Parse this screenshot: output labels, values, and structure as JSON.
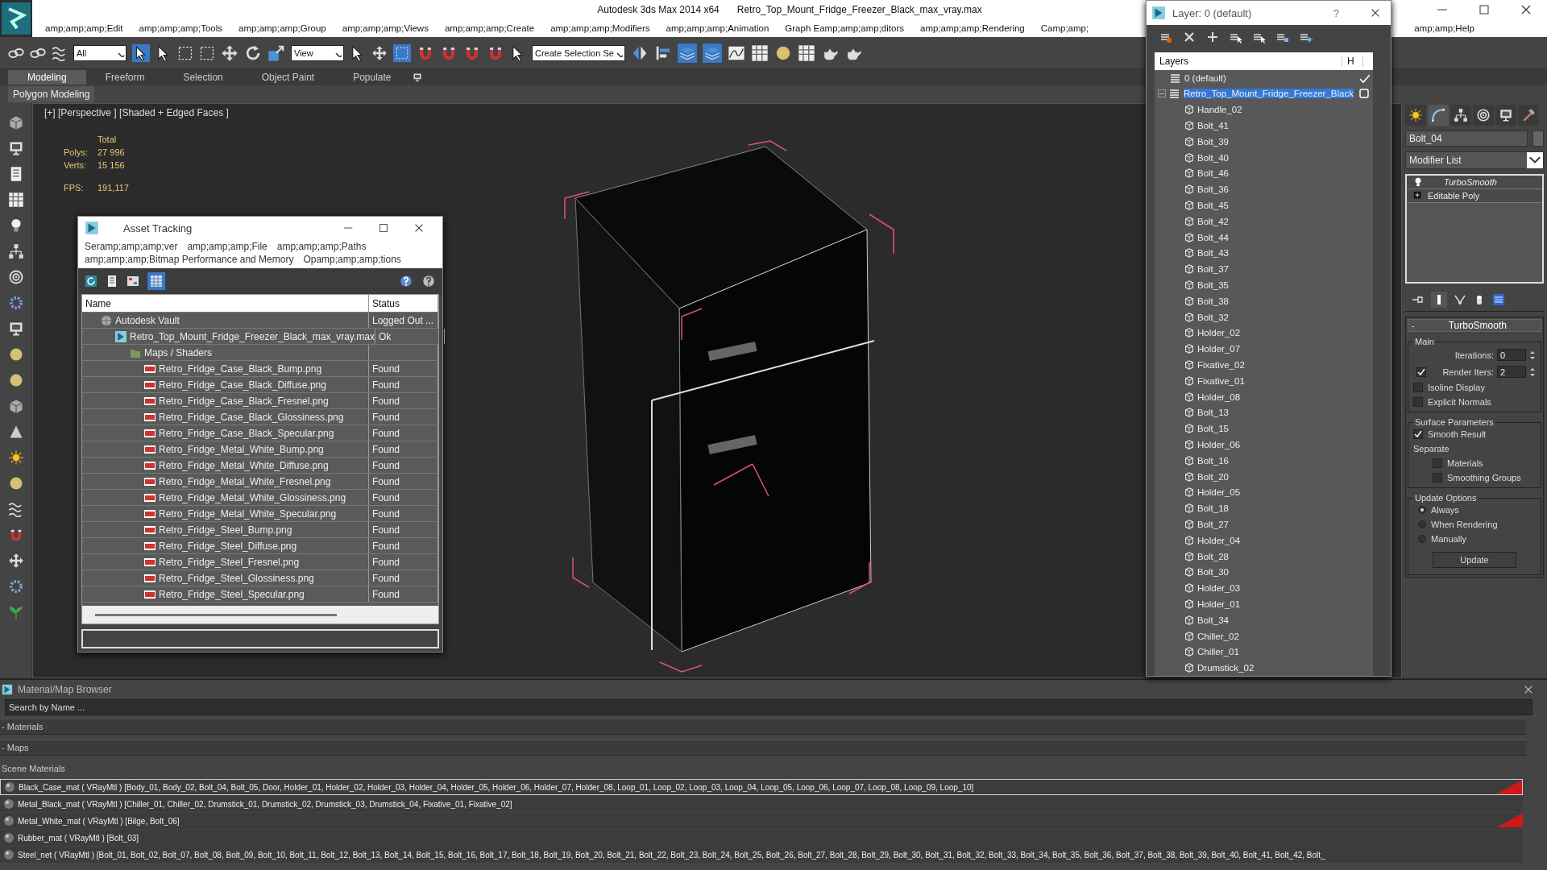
{
  "window": {
    "app_title": "Autodesk 3ds Max  2014 x64",
    "file_title": "Retro_Top_Mount_Fridge_Freezer_Black_max_vray.max"
  },
  "menu": [
    "amp;amp;amp;Edit",
    "amp;amp;amp;Tools",
    "amp;amp;amp;Group",
    "amp;amp;amp;Views",
    "amp;amp;amp;Create",
    "amp;amp;amp;Modifiers",
    "amp;amp;amp;Animation",
    "Graph Eamp;amp;amp;ditors",
    "amp;amp;amp;Rendering",
    "Camp;amp;",
    "amp;amp;Help"
  ],
  "toolbar": {
    "selection_filter": "All",
    "reference_coord": "View",
    "named_selection": "Create Selection Se"
  },
  "ribbon": {
    "tabs": [
      {
        "label": "Modeling",
        "selected": true
      },
      {
        "label": "Freeform",
        "selected": false
      },
      {
        "label": "Selection",
        "selected": false
      },
      {
        "label": "Object Paint",
        "selected": false
      },
      {
        "label": "Populate",
        "selected": false
      }
    ],
    "panel_label": "Polygon Modeling"
  },
  "viewport": {
    "label": "[+] [Perspective ] [Shaded + Edged Faces ]",
    "stats_heading": "Total",
    "stats": [
      {
        "label": "Polys:",
        "value": "27 996"
      },
      {
        "label": "Verts:",
        "value": "15 156"
      },
      {
        "label": "FPS:",
        "value": "191,117"
      }
    ]
  },
  "asset_tracking": {
    "title": "Asset Tracking",
    "menu": [
      "Seramp;amp;amp;ver",
      "amp;amp;amp;File",
      "amp;amp;amp;Paths",
      "amp;amp;amp;Bitmap Performance and Memory",
      "Opamp;amp;amp;tions"
    ],
    "columns": [
      "Name",
      "Status"
    ],
    "rows": [
      {
        "name": "Autodesk Vault",
        "kind": "vault",
        "status": "Logged Out ...",
        "children": [
          {
            "name": "Retro_Top_Mount_Fridge_Freezer_Black_max_vray.max",
            "kind": "scene",
            "status": "Ok",
            "children": [
              {
                "name": "Maps / Shaders",
                "kind": "folder",
                "children": [
                  {
                    "name": "Retro_Fridge_Case_Black_Bump.png",
                    "kind": "png",
                    "status": "Found"
                  },
                  {
                    "name": "Retro_Fridge_Case_Black_Diffuse.png",
                    "kind": "png",
                    "status": "Found"
                  },
                  {
                    "name": "Retro_Fridge_Case_Black_Fresnel.png",
                    "kind": "png",
                    "status": "Found"
                  },
                  {
                    "name": "Retro_Fridge_Case_Black_Glossiness.png",
                    "kind": "png",
                    "status": "Found"
                  },
                  {
                    "name": "Retro_Fridge_Case_Black_Specular.png",
                    "kind": "png",
                    "status": "Found"
                  },
                  {
                    "name": "Retro_Fridge_Metal_White_Bump.png",
                    "kind": "png",
                    "status": "Found"
                  },
                  {
                    "name": "Retro_Fridge_Metal_White_Diffuse.png",
                    "kind": "png",
                    "status": "Found"
                  },
                  {
                    "name": "Retro_Fridge_Metal_White_Fresnel.png",
                    "kind": "png",
                    "status": "Found"
                  },
                  {
                    "name": "Retro_Fridge_Metal_White_Glossiness.png",
                    "kind": "png",
                    "status": "Found"
                  },
                  {
                    "name": "Retro_Fridge_Metal_White_Specular.png",
                    "kind": "png",
                    "status": "Found"
                  },
                  {
                    "name": "Retro_Fridge_Steel_Bump.png",
                    "kind": "png",
                    "status": "Found"
                  },
                  {
                    "name": "Retro_Fridge_Steel_Diffuse.png",
                    "kind": "png",
                    "status": "Found"
                  },
                  {
                    "name": "Retro_Fridge_Steel_Fresnel.png",
                    "kind": "png",
                    "status": "Found"
                  },
                  {
                    "name": "Retro_Fridge_Steel_Glossiness.png",
                    "kind": "png",
                    "status": "Found"
                  },
                  {
                    "name": "Retro_Fridge_Steel_Specular.png",
                    "kind": "png",
                    "status": "Found"
                  }
                ]
              }
            ]
          }
        ]
      }
    ]
  },
  "layer_window": {
    "title": "Layer: 0 (default)",
    "help": "?",
    "columns": [
      "Layers",
      "H"
    ],
    "layers": [
      {
        "name": "0 (default)",
        "current": true,
        "selected": false
      },
      {
        "name": "Retro_Top_Mount_Fridge_Freezer_Black",
        "current": false,
        "selected": true,
        "expanded": true,
        "children": [
          {
            "name": "Handle_02",
            "selected": false
          },
          {
            "name": "Bolt_41",
            "selected": false
          },
          {
            "name": "Bolt_39",
            "selected": false
          },
          {
            "name": "Bolt_40",
            "selected": false
          },
          {
            "name": "Bolt_46",
            "selected": false
          },
          {
            "name": "Bolt_36",
            "selected": false
          },
          {
            "name": "Bolt_45",
            "selected": false
          },
          {
            "name": "Bolt_42",
            "selected": false
          },
          {
            "name": "Bolt_44",
            "selected": false
          },
          {
            "name": "Bolt_43",
            "selected": false
          },
          {
            "name": "Bolt_37",
            "selected": false
          },
          {
            "name": "Bolt_35",
            "selected": false
          },
          {
            "name": "Bolt_38",
            "selected": false
          },
          {
            "name": "Bolt_32",
            "selected": false
          },
          {
            "name": "Holder_02",
            "selected": false
          },
          {
            "name": "Holder_07",
            "selected": false
          },
          {
            "name": "Fixative_02",
            "selected": false
          },
          {
            "name": "Fixative_01",
            "selected": false
          },
          {
            "name": "Holder_08",
            "selected": false
          },
          {
            "name": "Bolt_13",
            "selected": false
          },
          {
            "name": "Bolt_15",
            "selected": false
          },
          {
            "name": "Holder_06",
            "selected": false
          },
          {
            "name": "Bolt_16",
            "selected": false
          },
          {
            "name": "Bolt_20",
            "selected": false
          },
          {
            "name": "Holder_05",
            "selected": false
          },
          {
            "name": "Bolt_18",
            "selected": false
          },
          {
            "name": "Bolt_27",
            "selected": false
          },
          {
            "name": "Holder_04",
            "selected": false
          },
          {
            "name": "Bolt_28",
            "selected": false
          },
          {
            "name": "Bolt_30",
            "selected": false
          },
          {
            "name": "Holder_03",
            "selected": false
          },
          {
            "name": "Holder_01",
            "selected": false
          },
          {
            "name": "Bolt_34",
            "selected": false
          },
          {
            "name": "Chiller_02",
            "selected": false
          },
          {
            "name": "Chiller_01",
            "selected": false
          },
          {
            "name": "Drumstick_02",
            "selected": false
          }
        ]
      }
    ]
  },
  "command_panel": {
    "tabs": [
      {
        "kind": "create",
        "selected": false
      },
      {
        "kind": "modify",
        "selected": true
      },
      {
        "kind": "hierarchy",
        "selected": false
      },
      {
        "kind": "motion",
        "selected": false
      },
      {
        "kind": "display",
        "selected": false
      },
      {
        "kind": "utilities",
        "selected": false
      }
    ],
    "object_name": "Bolt_04",
    "modifier_list": "Modifier List",
    "stack": [
      {
        "name": "TurboSmooth",
        "kind": "modifier"
      },
      {
        "name": "Editable Poly",
        "kind": "base"
      }
    ],
    "rollout": {
      "toggle": "-",
      "title": "TurboSmooth",
      "main": {
        "title": "Main",
        "iterations": {
          "label": "Iterations:",
          "value": "0"
        },
        "render_iters": {
          "label": "Render Iters:",
          "value": "2",
          "checked": true
        },
        "options": [
          {
            "label": "Isoline Display",
            "checked": false
          },
          {
            "label": "Explicit Normals",
            "checked": false
          }
        ]
      },
      "surface": {
        "title": "Surface Parameters",
        "smooth_result": {
          "label": "Smooth Result",
          "checked": true
        },
        "separate_label": "Separate",
        "separate": [
          {
            "label": "Materials",
            "checked": false
          },
          {
            "label": "Smoothing Groups",
            "checked": false
          }
        ]
      },
      "update": {
        "title": "Update Options",
        "options": [
          {
            "label": "Always",
            "selected": true
          },
          {
            "label": "When Rendering",
            "selected": false
          },
          {
            "label": "Manually",
            "selected": false
          }
        ],
        "button": "Update"
      }
    }
  },
  "material_browser": {
    "title": "Material/Map Browser",
    "search_placeholder": "Search by Name ...",
    "groups": [
      "- Materials",
      "- Maps"
    ],
    "scene_group": "Scene Materials",
    "materials": [
      {
        "text": "Black_Case_mat  ( VRayMtl ) [Body_01, Body_02, Bolt_04, Bolt_05, Door, Holder_01, Holder_02, Holder_03, Holder_04, Holder_05, Holder_06, Holder_07, Holder_08, Loop_01, Loop_02, Loop_03, Loop_04, Loop_05, Loop_06, Loop_07, Loop_08, Loop_09, Loop_10]",
        "selected": true,
        "flagged": true
      },
      {
        "text": "Metal_Black_mat  ( VRayMtl ) [Chiller_01, Chiller_02, Drumstick_01, Drumstick_02, Drumstick_03, Drumstick_04, Fixative_01, Fixative_02]",
        "selected": false,
        "flagged": false
      },
      {
        "text": "Metal_White_mat  ( VRayMtl ) [Bilge, Bolt_06]",
        "selected": false,
        "flagged": true
      },
      {
        "text": "Rubber_mat  ( VRayMtl ) [Bolt_03]",
        "selected": false,
        "flagged": false
      },
      {
        "text": "Steel_net  ( VRayMtl ) [Bolt_01, Bolt_02, Bolt_07, Bolt_08, Bolt_09, Bolt_10, Bolt_11, Bolt_12, Bolt_13, Bolt_14, Bolt_15, Bolt_16, Bolt_17, Bolt_18, Bolt_19, Bolt_20, Bolt_21, Bolt_22, Bolt_23, Bolt_24, Bolt_25, Bolt_26, Bolt_27, Bolt_28, Bolt_29, Bolt_30, Bolt_31, Bolt_32, Bolt_33, Bolt_34, Bolt_35, Bolt_36, Bolt_37, Bolt_38, Bolt_39, Bolt_40, Bolt_41, Bolt_42, Bolt_",
        "selected": false,
        "flagged": false
      }
    ]
  }
}
